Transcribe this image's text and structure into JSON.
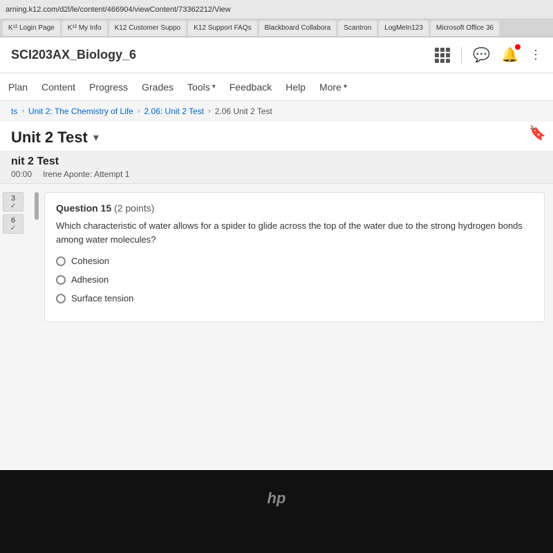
{
  "browser": {
    "url": "arning.k12.com/d2l/le/content/466904/viewContent/73362212/View",
    "tabs": [
      {
        "label": "K¹² Login Page",
        "active": false
      },
      {
        "label": "K¹² My Info",
        "active": false
      },
      {
        "label": "K12 Customer Suppo",
        "active": false
      },
      {
        "label": "K12 Support FAQs",
        "active": false
      },
      {
        "label": "Blackboard Collabora",
        "active": false
      },
      {
        "label": "Scantron",
        "active": false
      },
      {
        "label": "LogMeIn123",
        "active": false
      },
      {
        "label": "Microsoft Office 36",
        "active": false
      }
    ]
  },
  "course": {
    "title": "SCI203AX_Biology_6"
  },
  "nav": {
    "items": [
      "Plan",
      "Content",
      "Progress",
      "Grades"
    ],
    "tools_label": "Tools",
    "feedback_label": "Feedback",
    "help_label": "Help",
    "more_label": "More"
  },
  "breadcrumb": {
    "items": [
      "ts",
      "Unit 2: The Chemistry of Life",
      "2.06: Unit 2 Test",
      "2.06 Unit 2 Test"
    ]
  },
  "page_title": "Unit 2 Test",
  "test": {
    "title": "nit 2 Test",
    "timer": "00:00",
    "student": "Irene Aponte: Attempt 1"
  },
  "question": {
    "number": "Question 15",
    "points": "(2 points)",
    "text": "Which characteristic of water allows for a spider to glide across the top of the water due to the strong hydrogen bonds among water molecules?",
    "options": [
      {
        "label": "Cohesion"
      },
      {
        "label": "Adhesion"
      },
      {
        "label": "Surface tension"
      }
    ]
  },
  "sidebar": {
    "items": [
      {
        "number": "3",
        "check": "✓"
      },
      {
        "number": "6",
        "check": "✓"
      }
    ]
  }
}
